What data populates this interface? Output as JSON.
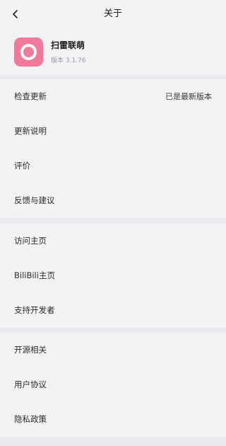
{
  "header": {
    "title": "关于",
    "back_icon": "chevron-left-icon"
  },
  "app": {
    "name": "扫雷联萌",
    "version": "版本 3.1.76",
    "icon": "app-ring-icon",
    "icon_color": "#f07a99"
  },
  "sections": [
    {
      "items": [
        {
          "label": "检查更新",
          "value": "已是最新版本"
        },
        {
          "label": "更新说明"
        },
        {
          "label": "评价"
        },
        {
          "label": "反馈与建议"
        }
      ]
    },
    {
      "items": [
        {
          "label": "访问主页"
        },
        {
          "label": "BiliBili主页"
        },
        {
          "label": "支持开发者"
        }
      ]
    },
    {
      "items": [
        {
          "label": "开源相关"
        },
        {
          "label": "用户协议"
        },
        {
          "label": "隐私政策"
        }
      ]
    }
  ],
  "colors": {
    "background": "#ebebef",
    "surface": "#f3f3f6"
  }
}
